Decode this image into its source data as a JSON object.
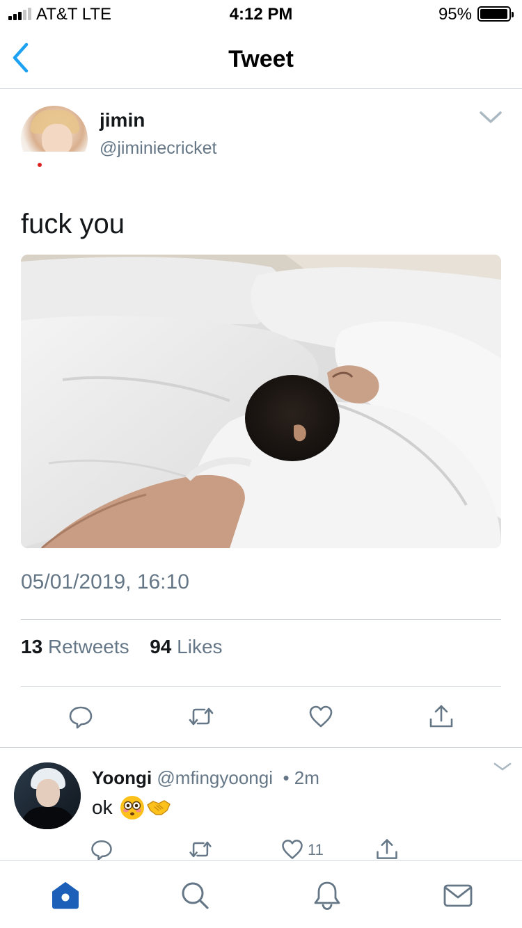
{
  "status_bar": {
    "carrier": "AT&T   LTE",
    "time": "4:12 PM",
    "battery": "95%",
    "battery_level": 0.95
  },
  "nav": {
    "title": "Tweet",
    "back_icon": "chevron-left-icon"
  },
  "tweet": {
    "author_name": "jimin",
    "author_handle": "@jiminiecricket",
    "text": "fuck you",
    "timestamp": "05/01/2019, 16:10",
    "retweet_count": "13",
    "retweet_label": "Retweets",
    "like_count": "94",
    "like_label": "Likes",
    "actions": [
      "reply-icon",
      "retweet-icon",
      "like-icon",
      "share-icon"
    ]
  },
  "reply": {
    "author_name": "Yoongi",
    "author_handle": "@mfingyoongi",
    "time": "2m",
    "text": "ok",
    "emojis": [
      "flushed-face-emoji",
      "handshake-emoji"
    ],
    "like_count": "11"
  },
  "tab_bar": {
    "items": [
      "home-icon",
      "search-icon",
      "notifications-icon",
      "messages-icon"
    ],
    "active": "home-icon"
  },
  "colors": {
    "accent": "#1DA1F2",
    "active_tab": "#1C5FB8",
    "secondary_text": "#657786",
    "divider": "#CFD5DA"
  }
}
